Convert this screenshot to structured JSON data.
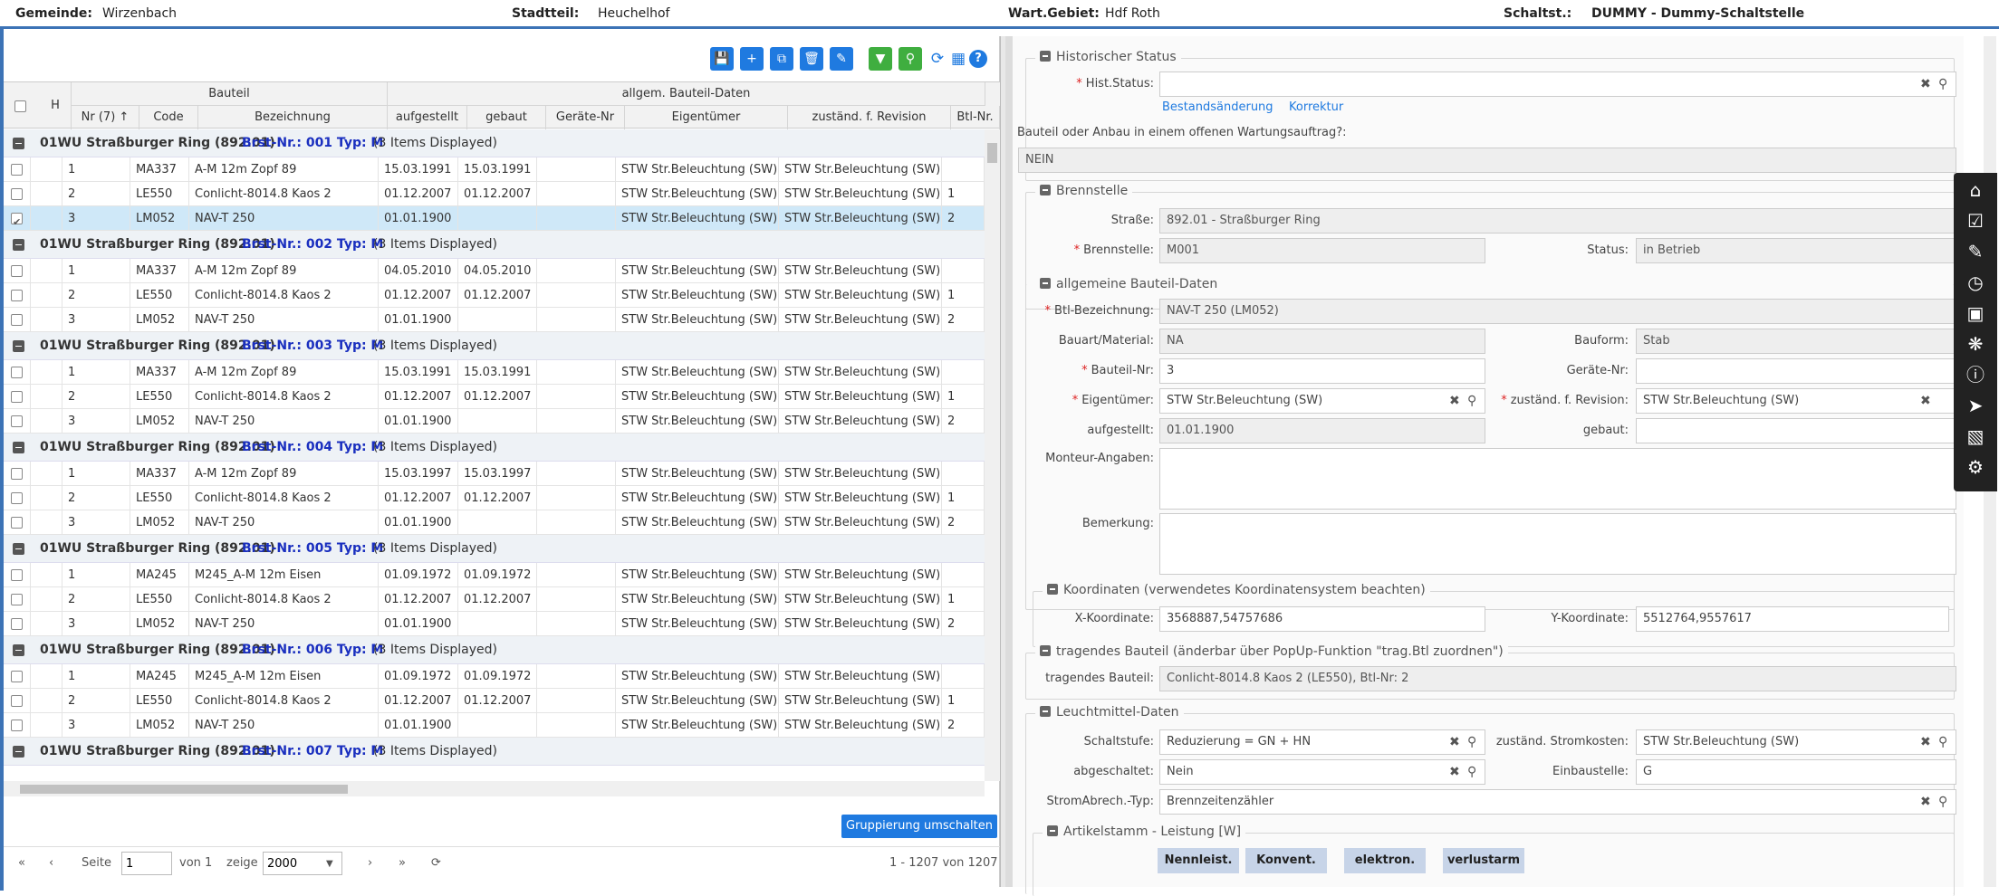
{
  "header": {
    "gemeinde_label": "Gemeinde:",
    "gemeinde_value": "Wirzenbach",
    "stadtteil_label": "Stadtteil:",
    "stadtteil_value": "Heuchelhof",
    "wartgebiet_label": "Wart.Gebiet:",
    "wartgebiet_value": "Hdf Roth",
    "schaltst_label": "Schaltst.:",
    "schaltst_value": "DUMMY - Dummy-Schaltstelle"
  },
  "toolbar": {
    "icons": [
      "save-icon",
      "add-icon",
      "copy-icon",
      "delete-icon",
      "edit-icon",
      "filter-icon",
      "search-icon",
      "refresh-icon",
      "calculator-icon",
      "help-icon"
    ],
    "help_glyph": "?"
  },
  "grid": {
    "header_h": "H",
    "group_bauteil": "Bauteil",
    "group_allgem": "allgem. Bauteil-Daten",
    "columns": [
      "Nr (7)",
      "Code",
      "Bezeichnung",
      "aufgestellt",
      "gebaut",
      "Geräte-Nr",
      "Eigentümer",
      "zuständ. f. Revision",
      "Btl-Nr."
    ],
    "groups": [
      {
        "street": "01WU Straßburger Ring (892.01)",
        "brst": "Brst-Nr.: 001 Typ: M",
        "count": "(3 Items Displayed)",
        "rows": [
          {
            "nr": "1",
            "code": "MA337",
            "bez": "A-M 12m Zopf 89",
            "aufg": "15.03.1991",
            "geb": "15.03.1991",
            "ger": "",
            "eig": "STW Str.Beleuchtung (SW)",
            "rev": "STW Str.Beleuchtung (SW)",
            "btl": ""
          },
          {
            "nr": "2",
            "code": "LE550",
            "bez": "Conlicht-8014.8 Kaos 2",
            "aufg": "01.12.2007",
            "geb": "01.12.2007",
            "ger": "",
            "eig": "STW Str.Beleuchtung (SW)",
            "rev": "STW Str.Beleuchtung (SW)",
            "btl": "1"
          },
          {
            "nr": "3",
            "code": "LM052",
            "bez": "NAV-T 250",
            "aufg": "01.01.1900",
            "geb": "",
            "ger": "",
            "eig": "STW Str.Beleuchtung (SW)",
            "rev": "STW Str.Beleuchtung (SW)",
            "btl": "2",
            "selected": true
          }
        ]
      },
      {
        "street": "01WU Straßburger Ring (892.01)",
        "brst": "Brst-Nr.: 002 Typ: M",
        "count": "(3 Items Displayed)",
        "rows": [
          {
            "nr": "1",
            "code": "MA337",
            "bez": "A-M 12m Zopf 89",
            "aufg": "04.05.2010",
            "geb": "04.05.2010",
            "ger": "",
            "eig": "STW Str.Beleuchtung (SW)",
            "rev": "STW Str.Beleuchtung (SW)",
            "btl": ""
          },
          {
            "nr": "2",
            "code": "LE550",
            "bez": "Conlicht-8014.8 Kaos 2",
            "aufg": "01.12.2007",
            "geb": "01.12.2007",
            "ger": "",
            "eig": "STW Str.Beleuchtung (SW)",
            "rev": "STW Str.Beleuchtung (SW)",
            "btl": "1"
          },
          {
            "nr": "3",
            "code": "LM052",
            "bez": "NAV-T 250",
            "aufg": "01.01.1900",
            "geb": "",
            "ger": "",
            "eig": "STW Str.Beleuchtung (SW)",
            "rev": "STW Str.Beleuchtung (SW)",
            "btl": "2"
          }
        ]
      },
      {
        "street": "01WU Straßburger Ring (892.01)",
        "brst": "Brst-Nr.: 003 Typ: M",
        "count": "(3 Items Displayed)",
        "rows": [
          {
            "nr": "1",
            "code": "MA337",
            "bez": "A-M 12m Zopf 89",
            "aufg": "15.03.1991",
            "geb": "15.03.1991",
            "ger": "",
            "eig": "STW Str.Beleuchtung (SW)",
            "rev": "STW Str.Beleuchtung (SW)",
            "btl": ""
          },
          {
            "nr": "2",
            "code": "LE550",
            "bez": "Conlicht-8014.8 Kaos 2",
            "aufg": "01.12.2007",
            "geb": "01.12.2007",
            "ger": "",
            "eig": "STW Str.Beleuchtung (SW)",
            "rev": "STW Str.Beleuchtung (SW)",
            "btl": "1"
          },
          {
            "nr": "3",
            "code": "LM052",
            "bez": "NAV-T 250",
            "aufg": "01.01.1900",
            "geb": "",
            "ger": "",
            "eig": "STW Str.Beleuchtung (SW)",
            "rev": "STW Str.Beleuchtung (SW)",
            "btl": "2"
          }
        ]
      },
      {
        "street": "01WU Straßburger Ring (892.01)",
        "brst": "Brst-Nr.: 004 Typ: M",
        "count": "(3 Items Displayed)",
        "rows": [
          {
            "nr": "1",
            "code": "MA337",
            "bez": "A-M 12m Zopf 89",
            "aufg": "15.03.1997",
            "geb": "15.03.1997",
            "ger": "",
            "eig": "STW Str.Beleuchtung (SW)",
            "rev": "STW Str.Beleuchtung (SW)",
            "btl": ""
          },
          {
            "nr": "2",
            "code": "LE550",
            "bez": "Conlicht-8014.8 Kaos 2",
            "aufg": "01.12.2007",
            "geb": "01.12.2007",
            "ger": "",
            "eig": "STW Str.Beleuchtung (SW)",
            "rev": "STW Str.Beleuchtung (SW)",
            "btl": "1"
          },
          {
            "nr": "3",
            "code": "LM052",
            "bez": "NAV-T 250",
            "aufg": "01.01.1900",
            "geb": "",
            "ger": "",
            "eig": "STW Str.Beleuchtung (SW)",
            "rev": "STW Str.Beleuchtung (SW)",
            "btl": "2"
          }
        ]
      },
      {
        "street": "01WU Straßburger Ring (892.01)",
        "brst": "Brst-Nr.: 005 Typ: M",
        "count": "(3 Items Displayed)",
        "rows": [
          {
            "nr": "1",
            "code": "MA245",
            "bez": "M245_A-M 12m Eisen",
            "aufg": "01.09.1972",
            "geb": "01.09.1972",
            "ger": "",
            "eig": "STW Str.Beleuchtung (SW)",
            "rev": "STW Str.Beleuchtung (SW)",
            "btl": ""
          },
          {
            "nr": "2",
            "code": "LE550",
            "bez": "Conlicht-8014.8 Kaos 2",
            "aufg": "01.12.2007",
            "geb": "01.12.2007",
            "ger": "",
            "eig": "STW Str.Beleuchtung (SW)",
            "rev": "STW Str.Beleuchtung (SW)",
            "btl": "1"
          },
          {
            "nr": "3",
            "code": "LM052",
            "bez": "NAV-T 250",
            "aufg": "01.01.1900",
            "geb": "",
            "ger": "",
            "eig": "STW Str.Beleuchtung (SW)",
            "rev": "STW Str.Beleuchtung (SW)",
            "btl": "2"
          }
        ]
      },
      {
        "street": "01WU Straßburger Ring (892.01)",
        "brst": "Brst-Nr.: 006 Typ: M",
        "count": "(3 Items Displayed)",
        "rows": [
          {
            "nr": "1",
            "code": "MA245",
            "bez": "M245_A-M 12m Eisen",
            "aufg": "01.09.1972",
            "geb": "01.09.1972",
            "ger": "",
            "eig": "STW Str.Beleuchtung (SW)",
            "rev": "STW Str.Beleuchtung (SW)",
            "btl": ""
          },
          {
            "nr": "2",
            "code": "LE550",
            "bez": "Conlicht-8014.8 Kaos 2",
            "aufg": "01.12.2007",
            "geb": "01.12.2007",
            "ger": "",
            "eig": "STW Str.Beleuchtung (SW)",
            "rev": "STW Str.Beleuchtung (SW)",
            "btl": "1"
          },
          {
            "nr": "3",
            "code": "LM052",
            "bez": "NAV-T 250",
            "aufg": "01.01.1900",
            "geb": "",
            "ger": "",
            "eig": "STW Str.Beleuchtung (SW)",
            "rev": "STW Str.Beleuchtung (SW)",
            "btl": "2"
          }
        ]
      },
      {
        "street": "01WU Straßburger Ring (892.01)",
        "brst": "Brst-Nr.: 007 Typ: M",
        "count": "(3 Items Displayed)",
        "rows": []
      }
    ]
  },
  "footer": {
    "toggle_button": "Gruppierung umschalten",
    "seite_label": "Seite",
    "page_value": "1",
    "von_label": "von 1",
    "zeige_label": "zeige",
    "page_size": "2000",
    "range_text": "1 - 1207 von 1207"
  },
  "form": {
    "hist": {
      "legend": "Historischer Status",
      "status_label": "Hist.Status:",
      "status_value": "",
      "link1": "Bestandsänderung",
      "link2": "Korrektur",
      "question": "Bauteil oder Anbau in einem offenen Wartungsauftrag?:",
      "answer": "NEIN"
    },
    "brenn": {
      "legend": "Brennstelle",
      "strasse_label": "Straße:",
      "strasse_value": "892.01 - Straßburger Ring",
      "brenn_label": "Brennstelle:",
      "brenn_value": "M001",
      "status_label": "Status:",
      "status_value": "in Betrieb"
    },
    "allg": {
      "legend": "allgemeine Bauteil-Daten",
      "btl_label": "Btl-Bezeichnung:",
      "btl_value": "NAV-T 250 (LM052)",
      "bauart_label": "Bauart/Material:",
      "bauart_value": "NA",
      "bauform_label": "Bauform:",
      "bauform_value": "Stab",
      "bauteilnr_label": "Bauteil-Nr:",
      "bauteilnr_value": "3",
      "geraete_label": "Geräte-Nr:",
      "geraete_value": "",
      "eig_label": "Eigentümer:",
      "eig_value": "STW Str.Beleuchtung (SW)",
      "rev_label": "zuständ. f. Revision:",
      "rev_value": "STW Str.Beleuchtung (SW)",
      "aufg_label": "aufgestellt:",
      "aufg_value": "01.01.1900",
      "geb_label": "gebaut:",
      "geb_value": "",
      "monteur_label": "Monteur-Angaben:",
      "bemerkung_label": "Bemerkung:"
    },
    "koord": {
      "legend": "Koordinaten (verwendetes Koordinatensystem beachten)",
      "x_label": "X-Koordinate:",
      "x_value": "3568887,54757686",
      "y_label": "Y-Koordinate:",
      "y_value": "5512764,9557617"
    },
    "trag": {
      "legend": "tragendes Bauteil (änderbar über PopUp-Funktion \"trag.Btl zuordnen\")",
      "label": "tragendes Bauteil:",
      "value": "Conlicht-8014.8 Kaos 2 (LE550),  Btl-Nr: 2"
    },
    "leucht": {
      "legend": "Leuchtmittel-Daten",
      "schalt_label": "Schaltstufe:",
      "schalt_value": "Reduzierung = GN + HN",
      "strom_label": "zuständ. Stromkosten:",
      "strom_value": "STW Str.Beleuchtung (SW)",
      "abg_label": "abgeschaltet:",
      "abg_value": "Nein",
      "einbau_label": "Einbaustelle:",
      "einbau_value": "G",
      "abrech_label": "StromAbrech.-Typ:",
      "abrech_value": "Brennzeitenzähler"
    },
    "artikel": {
      "legend": "Artikelstamm - Leistung [W]",
      "chips": [
        "Nennleist.",
        "Konvent.",
        "elektron.",
        "verlustarm"
      ]
    }
  },
  "sidebar": {
    "icons": [
      "home-icon",
      "checklist-icon",
      "edit-icon",
      "clock-icon",
      "screen-icon",
      "bug-icon",
      "info-icon",
      "cursor-icon",
      "paint-roller-icon",
      "settings-icon"
    ]
  }
}
